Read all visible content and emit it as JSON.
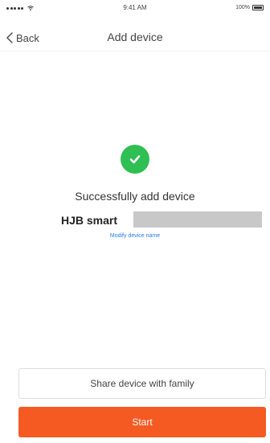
{
  "status_bar": {
    "carrier": "",
    "time": "9:41 AM",
    "battery": "100%"
  },
  "nav": {
    "back_label": "Back",
    "title": "Add device"
  },
  "result": {
    "status_icon": "check-circle-icon",
    "message": "Successfully add device",
    "device_name": "HJB smart",
    "modify_link": "Modify device name"
  },
  "actions": {
    "share_label": "Share device with family",
    "start_label": "Start"
  },
  "colors": {
    "success": "#2fbf53",
    "accent": "#f55a22",
    "link": "#2a7ae4"
  }
}
